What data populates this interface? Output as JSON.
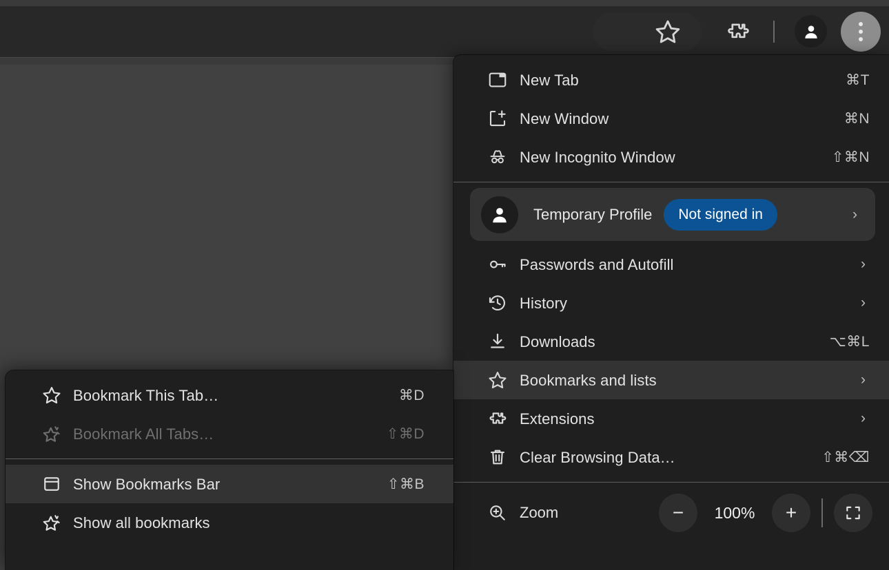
{
  "toolbar": {
    "star_icon": "bookmark-star-icon",
    "extensions_icon": "extensions-puzzle-icon",
    "profile_icon": "account-avatar-icon",
    "menu_icon": "three-dot-menu-icon"
  },
  "main_menu": {
    "groups": [
      {
        "items": [
          {
            "icon": "new-tab-icon",
            "label": "New Tab",
            "accel": "⌘T",
            "arrow": false,
            "highlighted": false
          },
          {
            "icon": "new-window-icon",
            "label": "New Window",
            "accel": "⌘N",
            "arrow": false,
            "highlighted": false
          },
          {
            "icon": "incognito-icon",
            "label": "New Incognito Window",
            "accel": "⇧⌘N",
            "arrow": false,
            "highlighted": false
          }
        ]
      }
    ],
    "profile": {
      "avatar_icon": "account-avatar-icon",
      "name": "Temporary Profile",
      "badge": "Not signed in",
      "arrow": "›"
    },
    "items2": [
      {
        "icon": "key-icon",
        "label": "Passwords and Autofill",
        "accel": "",
        "arrow": true,
        "highlighted": false
      },
      {
        "icon": "history-icon",
        "label": "History",
        "accel": "",
        "arrow": true,
        "highlighted": false
      },
      {
        "icon": "download-icon",
        "label": "Downloads",
        "accel": "⌥⌘L",
        "arrow": false,
        "highlighted": false
      },
      {
        "icon": "star-icon",
        "label": "Bookmarks and lists",
        "accel": "",
        "arrow": true,
        "highlighted": true
      },
      {
        "icon": "puzzle-icon",
        "label": "Extensions",
        "accel": "",
        "arrow": true,
        "highlighted": false
      },
      {
        "icon": "trash-icon",
        "label": "Clear Browsing Data…",
        "accel": "⇧⌘⌫",
        "arrow": false,
        "highlighted": false
      }
    ],
    "zoom": {
      "icon": "zoom-magnifier-icon",
      "label": "Zoom",
      "minus_label": "−",
      "percent": "100%",
      "plus_label": "+",
      "fullscreen_icon": "fullscreen-icon"
    }
  },
  "bookmarks_submenu": {
    "group1": [
      {
        "icon": "star-outline-icon",
        "label": "Bookmark This Tab…",
        "accel": "⌘D",
        "disabled": false,
        "highlighted": false
      },
      {
        "icon": "star-all-tabs-icon",
        "label": "Bookmark All Tabs…",
        "accel": "⇧⌘D",
        "disabled": true,
        "highlighted": false
      }
    ],
    "group2": [
      {
        "icon": "bookmarks-bar-icon",
        "label": "Show Bookmarks Bar",
        "accel": "⇧⌘B",
        "disabled": false,
        "highlighted": true
      },
      {
        "icon": "show-all-bookmarks-icon",
        "label": "Show all bookmarks",
        "accel": "",
        "disabled": false,
        "highlighted": false
      }
    ]
  },
  "colors": {
    "menu_bg": "#1f1f1f",
    "highlight": "#333333",
    "badge_blue": "#0b5394",
    "text": "#e3e3e3",
    "separator": "#5e5e5e"
  }
}
